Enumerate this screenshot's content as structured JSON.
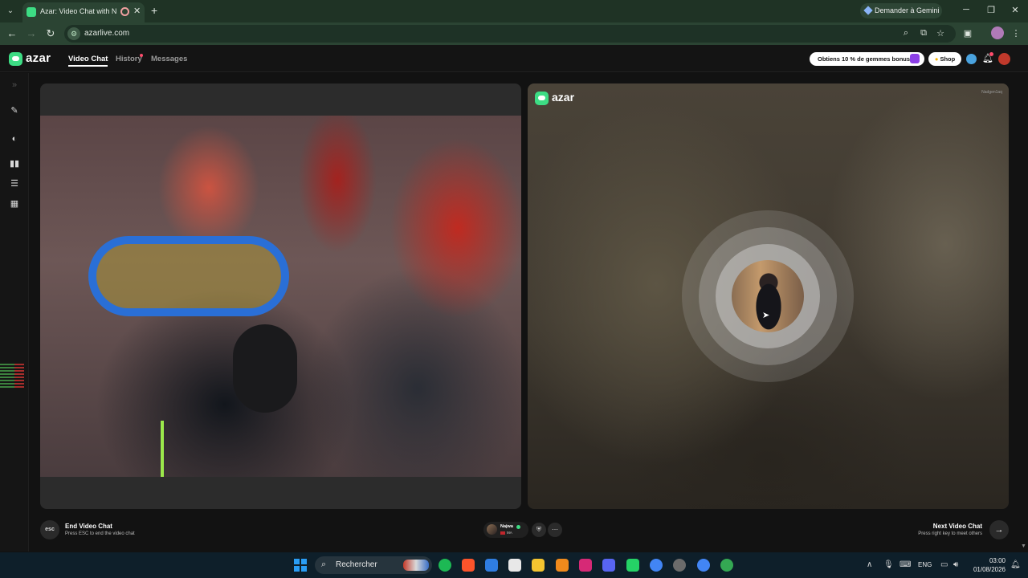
{
  "browser": {
    "tab_title": "Azar: Video Chat with New",
    "gemini_label": "Demander à Gemini",
    "url": "azarlive.com"
  },
  "app": {
    "logo": "azar",
    "nav": [
      {
        "label": "Video Chat",
        "active": true
      },
      {
        "label": "History",
        "active": false
      },
      {
        "label": "Messages",
        "active": false
      }
    ],
    "promo_label": "Obtiens 10 % de gemmes bonus !",
    "shop_label": "Shop"
  },
  "video": {
    "watermark": "azar",
    "match_id": "Nadgen1aq"
  },
  "controls": {
    "esc_label": "esc",
    "end_title": "End Video Chat",
    "end_subtitle": "Press ESC to end the video chat",
    "partner_name": "Najwa",
    "partner_country": "MA",
    "next_title": "Next Video Chat",
    "next_subtitle": "Press right key to meet others"
  },
  "taskbar": {
    "search_placeholder": "Rechercher",
    "language": "ENG",
    "time": "03:00",
    "date": "01/08/2026"
  },
  "colors": {
    "brand_green": "#3ddc84",
    "chrome_dark": "#1f3325",
    "chrome_toolbar": "#2b4433",
    "notification_red": "#ff4d6d"
  }
}
